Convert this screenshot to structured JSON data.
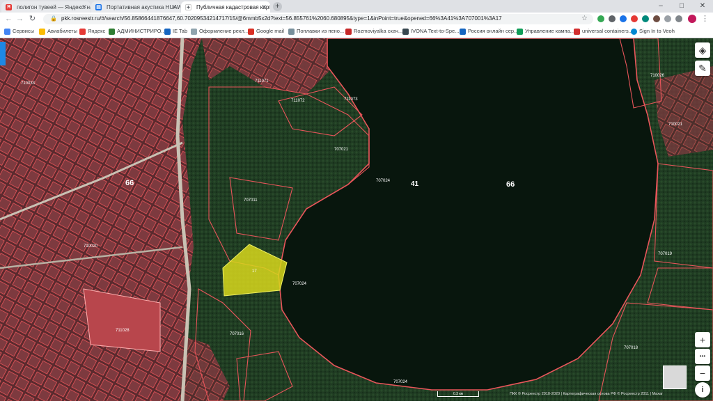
{
  "tabs": [
    {
      "title": "полигон тувеей — Яндекс: нашл",
      "favicon": "Я",
      "color": "#e53935"
    },
    {
      "title": "Портативная акустика HUAWEI",
      "favicon": "🛒",
      "color": "#1a73e8"
    },
    {
      "title": "Публичная кадастровая карта",
      "favicon": "✦",
      "color": "#5f6368",
      "active": true
    }
  ],
  "toolbar": {
    "url": "pkk.rosreestr.ru/#/search/56.85866441876647,60.70209534214717/15/@6mmb5x2d?text=56.855761%2060.680895&type=1&inPoint=true&opened=66%3A41%3A707001%3A17"
  },
  "bookmarks": [
    {
      "label": "Сервисы",
      "color": "#4285f4"
    },
    {
      "label": "Авиабилеты",
      "color": "#fbbc04"
    },
    {
      "label": "Яндекс",
      "color": "#e53935"
    },
    {
      "label": "АДМИНИСТРИРО...",
      "color": "#2e7d32"
    },
    {
      "label": "IE Tab",
      "color": "#1565c0"
    },
    {
      "label": "Оформление рекл...",
      "color": "#90a4ae"
    },
    {
      "label": "Google mail",
      "color": "#d93025"
    },
    {
      "label": "Поплавки из пено...",
      "color": "#78909c"
    },
    {
      "label": "Rozmoviyalka скач...",
      "color": "#c62828"
    },
    {
      "label": "IVONA Text-to-Spe...",
      "color": "#37474f"
    },
    {
      "label": "Россия онлайн сер...",
      "color": "#1565c0"
    },
    {
      "label": "Управление кампа...",
      "color": "#0f9d58"
    },
    {
      "label": "universal containers...",
      "color": "#d32f2f"
    },
    {
      "label": "Sign In to Veoh",
      "color": "#0288d1"
    }
  ],
  "map_labels": {
    "region_main": "66",
    "region_lake": "66",
    "district": "41",
    "lake_parcel_1": "707024",
    "lake_parcel_2": "707024",
    "lake_parcel_3": "707024",
    "quarter_east": "707019",
    "quarter_se": "707018",
    "quarter_sw": "707016",
    "quarter_n1": "707021",
    "quarter_mid": "707011",
    "quarter_nw": "711071",
    "quarter_nw2": "711072",
    "quarter_nw3": "711073",
    "quarter_ne": "710026",
    "quarter_ne2": "710021",
    "quarter_w": "710033",
    "quarter_w2": "710020",
    "quarter_sw2": "711028",
    "highlight_parcel": "17"
  },
  "controls": {
    "layers_icon": "layers-icon",
    "ruler_icon": "ruler-icon",
    "zoom_in": "+",
    "zoom_out": "−",
    "more": "•••",
    "info": "i"
  },
  "attribution": "ПКК © Росреестр 2010-2020 | Картографическая основа РФ © Росреестр 2011 | Maxar",
  "scale_label": "0.3 км",
  "colors": {
    "parcel_outline": "#e8555a",
    "highlight_fill": "#d8d81c",
    "water": "#08160d",
    "forest": "#1e3a22"
  }
}
